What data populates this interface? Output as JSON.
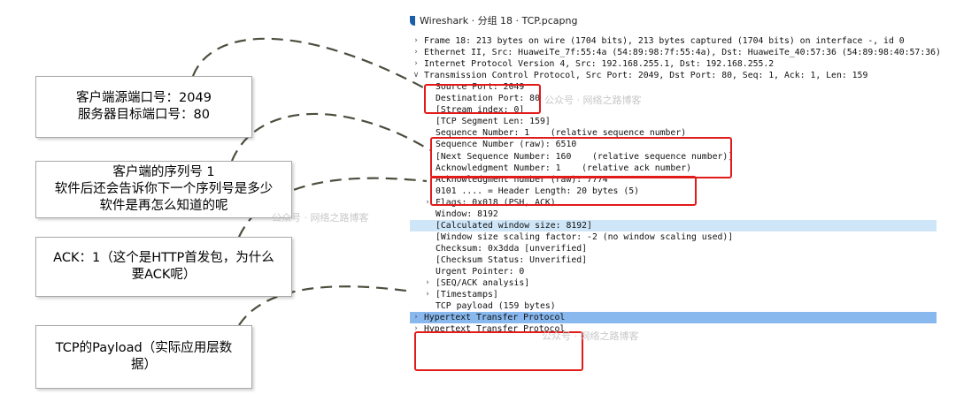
{
  "window": {
    "title": "Wireshark · 分组 18 · TCP.pcapng"
  },
  "annotations": [
    {
      "lines": [
        "客户端源端口号：2049",
        "服务器目标端口号：80"
      ]
    },
    {
      "lines": [
        "客户端的序列号 1",
        "软件后还会告诉你下一个序列号是多少",
        "软件是再怎么知道的呢"
      ]
    },
    {
      "lines": [
        "ACK：1（这个是HTTP首发包，为什么",
        "要ACK呢）"
      ]
    },
    {
      "lines": [
        "TCP的Payload（实际应用层数",
        "据）"
      ]
    }
  ],
  "packet_details": [
    {
      "text": "Frame 18: 213 bytes on wire (1704 bits), 213 bytes captured (1704 bits) on interface -, id 0",
      "expander": "collapsed",
      "state": ""
    },
    {
      "text": "Ethernet II, Src: HuaweiTe_7f:55:4a (54:89:98:7f:55:4a), Dst: HuaweiTe_40:57:36 (54:89:98:40:57:36)",
      "expander": "collapsed",
      "state": ""
    },
    {
      "text": "Internet Protocol Version 4, Src: 192.168.255.1, Dst: 192.168.255.2",
      "expander": "collapsed",
      "state": ""
    },
    {
      "text": "Transmission Control Protocol, Src Port: 2049, Dst Port: 80, Seq: 1, Ack: 1, Len: 159",
      "expander": "expanded",
      "state": ""
    },
    {
      "text": "Source Port: 2049",
      "expander": "none",
      "state": ""
    },
    {
      "text": "Destination Port: 80",
      "expander": "none",
      "state": ""
    },
    {
      "text": "[Stream index: 0]",
      "expander": "none",
      "state": ""
    },
    {
      "text": "[TCP Segment Len: 159]",
      "expander": "none",
      "state": ""
    },
    {
      "text": "Sequence Number: 1    (relative sequence number)",
      "expander": "none",
      "state": ""
    },
    {
      "text": "Sequence Number (raw): 6510",
      "expander": "none",
      "state": ""
    },
    {
      "text": "[Next Sequence Number: 160    (relative sequence number)]",
      "expander": "none",
      "state": ""
    },
    {
      "text": "Acknowledgment Number: 1    (relative ack number)",
      "expander": "none",
      "state": ""
    },
    {
      "text": "Acknowledgment number (raw): 7774",
      "expander": "none",
      "state": ""
    },
    {
      "text": "0101 .... = Header Length: 20 bytes (5)",
      "expander": "none",
      "state": ""
    },
    {
      "text": "Flags: 0x018 (PSH, ACK)",
      "expander": "collapsed",
      "state": ""
    },
    {
      "text": "Window: 8192",
      "expander": "none",
      "state": ""
    },
    {
      "text": "[Calculated window size: 8192]",
      "expander": "none",
      "state": "lightsel"
    },
    {
      "text": "[Window size scaling factor: -2 (no window scaling used)]",
      "expander": "none",
      "state": ""
    },
    {
      "text": "Checksum: 0x3dda [unverified]",
      "expander": "none",
      "state": ""
    },
    {
      "text": "[Checksum Status: Unverified]",
      "expander": "none",
      "state": ""
    },
    {
      "text": "Urgent Pointer: 0",
      "expander": "none",
      "state": ""
    },
    {
      "text": "[SEQ/ACK analysis]",
      "expander": "collapsed",
      "state": ""
    },
    {
      "text": "[Timestamps]",
      "expander": "collapsed",
      "state": ""
    },
    {
      "text": "TCP payload (159 bytes)",
      "expander": "none",
      "state": ""
    },
    {
      "text": "Hypertext Transfer Protocol",
      "expander": "collapsed",
      "state": "sel"
    },
    {
      "text": "Hypertext Transfer Protocol",
      "expander": "collapsed",
      "state": ""
    }
  ],
  "watermarks": [
    "公众号 · 网络之路博客",
    "公众号 · 网络之路博客",
    "公众号 · 网络之路博客"
  ],
  "colors": {
    "highlight_box": "#e21a1a",
    "selected_row": "#88b8ee",
    "light_selected_row": "#cfe6f8",
    "connector": "#4b4f3e"
  }
}
